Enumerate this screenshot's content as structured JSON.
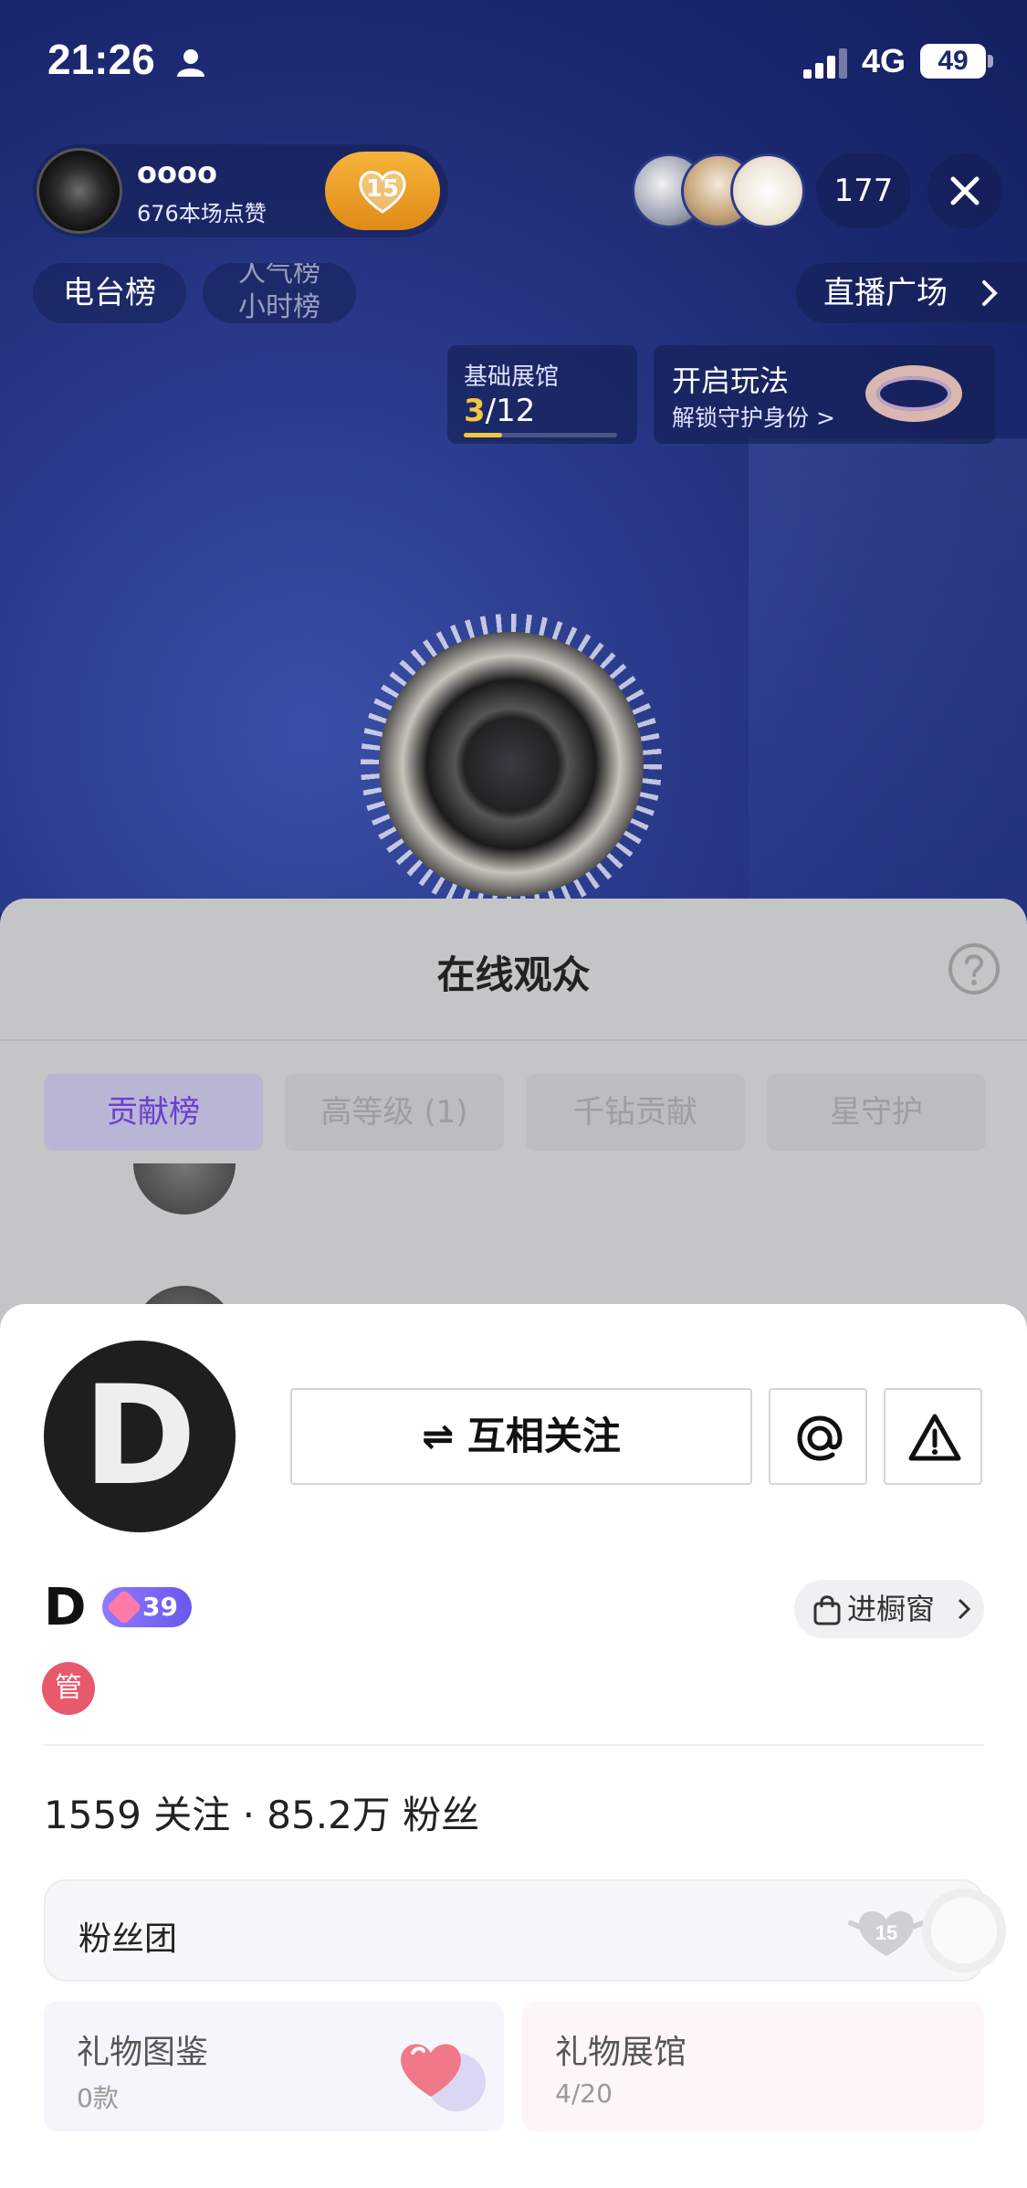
{
  "status_bar": {
    "time": "21:26",
    "network": "4G",
    "battery": "49"
  },
  "host": {
    "name": "oooo",
    "likes": "676本场点赞",
    "fan_level": "15"
  },
  "viewer_count": "177",
  "tags": {
    "radio_rank": "电台榜",
    "popularity_rank": "人气榜",
    "hourly_rank": "小时榜",
    "live_plaza": "直播广场"
  },
  "museum_card": {
    "title": "基础展馆",
    "progress_current": "3",
    "progress_total": "/12",
    "progress_fraction": 0.25
  },
  "play_card": {
    "title": "开启玩法",
    "subtitle": "解锁守护身份 >"
  },
  "viewer_sheet": {
    "title": "在线观众",
    "tabs": [
      "贡献榜",
      "高等级 (1)",
      "千钻贡献",
      "星守护"
    ],
    "active_tab": 0
  },
  "profile": {
    "avatar_letter": "D",
    "follow_label": "⇌ 互相关注",
    "name": "D",
    "level": "39",
    "shop_label": "进橱窗",
    "admin_badge": "管",
    "stats": "1559 关注 · 85.2万 粉丝",
    "fan_club_label": "粉丝团",
    "fan_club_level": "15",
    "gift_catalog": {
      "title": "礼物图鉴",
      "sub": "0款"
    },
    "gift_museum": {
      "title": "礼物展馆",
      "sub": "4/20"
    }
  },
  "colors": {
    "accent": "#6a3fd0",
    "fan_gold": "#f6b43a",
    "admin_red": "#e8596b",
    "level_purple": "#7a68f8"
  },
  "icons": [
    "user-icon",
    "signal-icon",
    "battery-icon",
    "heart-icon",
    "close-icon",
    "chevron-right-icon",
    "help-icon",
    "at-icon",
    "warning-icon",
    "bag-icon"
  ]
}
